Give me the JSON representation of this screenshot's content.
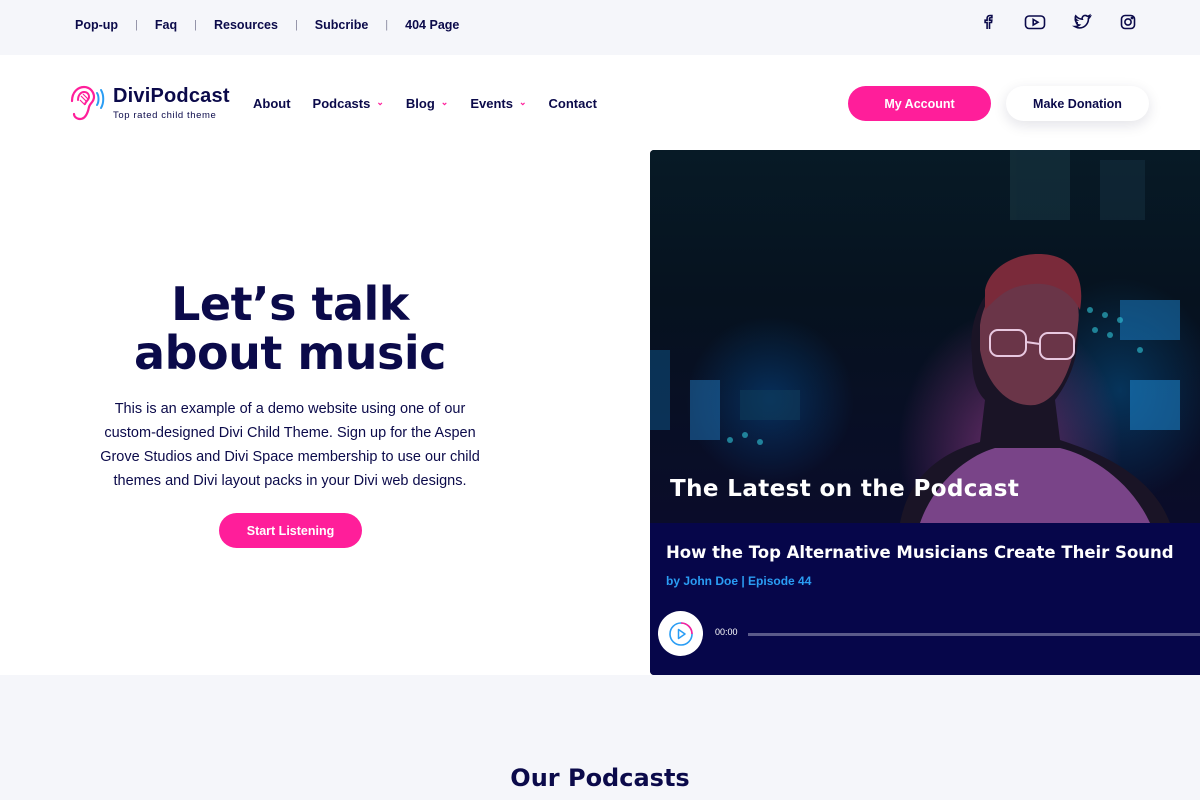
{
  "topbar": {
    "links": [
      "Pop-up",
      "Faq",
      "Resources",
      "Subcribe",
      "404 Page"
    ],
    "separator": "|",
    "social_icons": [
      "facebook-icon",
      "youtube-icon",
      "twitter-icon",
      "instagram-icon"
    ]
  },
  "header": {
    "logo_title": "DiviPodcast",
    "logo_tagline": "Top rated child theme",
    "nav": [
      {
        "label": "About",
        "has_dropdown": false
      },
      {
        "label": "Podcasts",
        "has_dropdown": true
      },
      {
        "label": "Blog",
        "has_dropdown": true
      },
      {
        "label": "Events",
        "has_dropdown": true
      },
      {
        "label": "Contact",
        "has_dropdown": false
      }
    ],
    "account_button": "My Account",
    "donate_button": "Make Donation"
  },
  "hero": {
    "title_line1": "Let’s talk",
    "title_line2": "about music",
    "text": "This is an example of a demo website using one of our custom-designed Divi Child Theme. Sign up for the Aspen Grove Studios and Divi Space membership to use our child themes and Divi layout packs in your Divi web designs.",
    "button": "Start Listening"
  },
  "card": {
    "overlay_title": "The Latest on the Podcast",
    "episode_title": "How the Top Alternative Musicians Create Their Sound",
    "episode_meta": "by John Doe | Episode 44",
    "player_time": "00:00"
  },
  "section": {
    "title": "Our Podcasts"
  },
  "colors": {
    "primary": "#ff1e9a",
    "navy": "#0b0a4a",
    "link_blue": "#2a9df4",
    "card_bg": "#06064a",
    "topbar_bg": "#f5f6fa"
  }
}
